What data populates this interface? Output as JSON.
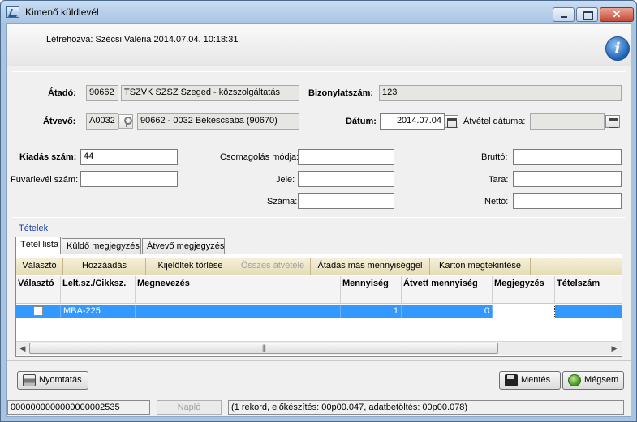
{
  "window": {
    "title": "Kimenő küldlevél",
    "close_glyph": "✕"
  },
  "header": {
    "created": "Létrehozva: Szécsi Valéria 2014.07.04. 10:18:31",
    "info_glyph": "i"
  },
  "form": {
    "atado_label": "Átadó:",
    "atado_code": "90662",
    "atado_name": "TSZVK SZSZ Szeged - közszolgáltatás",
    "bizonylat_label": "Bizonylatszám:",
    "bizonylat_value": "123",
    "atvevo_label": "Átvevő:",
    "atvevo_code": "A0032",
    "atvevo_name": "90662 - 0032 Békéscsaba (90670)",
    "datum_label": "Dátum:",
    "datum_value": "2014.07.04",
    "atvetel_datuma_label": "Átvétel dátuma:",
    "atvetel_datuma_value": "",
    "kiadas_szam_label": "Kiadás szám:",
    "kiadas_szam_value": "44",
    "fuvarlevel_label": "Fuvarlevél szám:",
    "fuvarlevel_value": "",
    "csomagolas_label": "Csomagolás módja:",
    "csomagolas_value": "",
    "jele_label": "Jele:",
    "jele_value": "",
    "szama_label": "Száma:",
    "szama_value": "",
    "brutto_label": "Bruttó:",
    "brutto_value": "",
    "tara_label": "Tara:",
    "tara_value": "",
    "netto_label": "Nettó:",
    "netto_value": ""
  },
  "items_section": {
    "label": "Tételek",
    "tabs": [
      "Tétel lista",
      "Küldő megjegyzés",
      "Átvevő megjegyzés"
    ],
    "toolbar": [
      "Választó",
      "Hozzáadás",
      "Kijelöltek törlése",
      "Összes átvétele",
      "Átadás más mennyiséggel",
      "Karton megtekintése"
    ],
    "columns": [
      "Választó",
      "Lelt.sz./Cikksz.",
      "Megnevezés",
      "Mennyiség",
      "Átvett mennyiség",
      "Megjegyzés",
      "Tételszám"
    ],
    "rows": [
      {
        "code": "MBA-225",
        "name": "",
        "qty": "1",
        "received": "0",
        "note": "",
        "item_no": ""
      }
    ],
    "scroll_left": "◀",
    "scroll_right": "▶",
    "scroll_grip": "|||"
  },
  "buttons": {
    "print": "Nyomtatás",
    "save": "Mentés",
    "cancel": "Mégsem"
  },
  "statusbar": {
    "id": "0000000000000000002535",
    "log_button": "Napló",
    "info": "(1 rekord, előkészítés: 00p00.047, adatbetöltés: 00p00.078)"
  }
}
